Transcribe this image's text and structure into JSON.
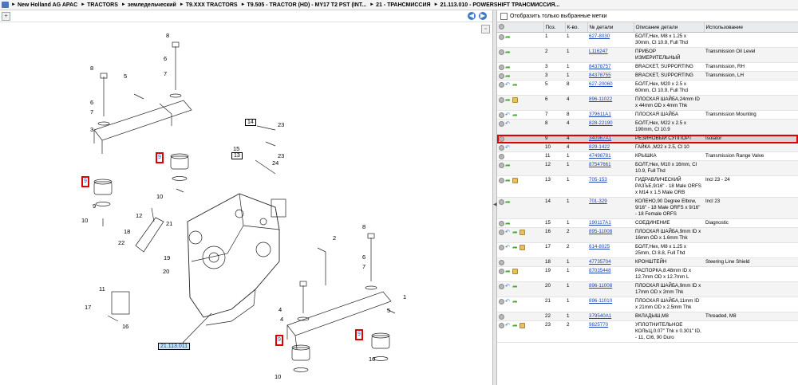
{
  "breadcrumb": [
    "New Holland AG APAC",
    "TRACTORS",
    "земледельческий",
    "T9.XXX TRACTORS",
    "T9.505 - TRACTOR (HD) - MY17 T2 PST (INT...",
    "21 - ТРАНСМИССИЯ",
    "21.113.010 - POWERSHIFT ТРАНСМИССИЯ..."
  ],
  "filter": {
    "label": "Отобразить только выбранные метки"
  },
  "table": {
    "headers": [
      "",
      "Поз.",
      "К-во.",
      "№ детали",
      "Описание детали",
      "Использование"
    ],
    "rows": [
      {
        "pos": "1",
        "qty": "1",
        "part": "627-8030",
        "desc": "БОЛТ,Hex, M8 x 1.25 x 30mm, Cl 10.9, Full Thd",
        "use": "",
        "icons": [
          "gray",
          "fwd"
        ]
      },
      {
        "pos": "2",
        "qty": "1",
        "part": "L116247",
        "desc": "ПРИБОР ИЗМЕРИТЕЛЬНЫЙ",
        "use": "Transmission Oil Level",
        "icons": [
          "gray",
          "fwd"
        ]
      },
      {
        "pos": "3",
        "qty": "1",
        "part": "84378757",
        "desc": "BRACKET, SUPPORTING",
        "use": "Transmission, RH",
        "icons": [
          "gray",
          "fwd"
        ]
      },
      {
        "pos": "3",
        "qty": "1",
        "part": "84378755",
        "desc": "BRACKET, SUPPORTING",
        "use": "Transmission, LH",
        "icons": [
          "gray",
          "fwd"
        ]
      },
      {
        "pos": "5",
        "qty": "8",
        "part": "627-20060",
        "desc": "БОЛТ,Hex, M20 x 2.5 x 60mm, Cl 10.9, Full Thd",
        "use": "",
        "icons": [
          "gray",
          "back",
          "fwd"
        ]
      },
      {
        "pos": "6",
        "qty": "4",
        "part": "896-11022",
        "desc": "ПЛОСКАЯ ШАЙБА,24mm ID x 44mm OD x 4mm Thk",
        "use": "",
        "icons": [
          "gray",
          "fwd",
          "box"
        ]
      },
      {
        "pos": "7",
        "qty": "8",
        "part": "379611A1",
        "desc": "ПЛОСКАЯ ШАЙБА",
        "use": "Transmission Mounting",
        "icons": [
          "gray",
          "back",
          "fwd"
        ]
      },
      {
        "pos": "8",
        "qty": "4",
        "part": "828-22190",
        "desc": "БОЛТ,Hex, M22 x 2.5 x 190mm, Cl 10.9",
        "use": "",
        "icons": [
          "gray",
          "back"
        ]
      },
      {
        "pos": "9",
        "qty": "4",
        "part": "340967A1",
        "desc": "РЕЗИНОВЫЙ СУППОРТ",
        "use": "Isolator",
        "icons": [
          "gray"
        ],
        "selected": true
      },
      {
        "pos": "10",
        "qty": "4",
        "part": "829-1422",
        "desc": "ГАЙКА ,M22 x 2.5, Cl 10",
        "use": "",
        "icons": [
          "gray",
          "back"
        ]
      },
      {
        "pos": "11",
        "qty": "1",
        "part": "47498781",
        "desc": "КРЫШКА",
        "use": "Transmission Range Valve",
        "icons": [
          "gray"
        ]
      },
      {
        "pos": "12",
        "qty": "1",
        "part": "87547661",
        "desc": "БОЛТ,Hex, M10 x 16mm, Cl 10.9, Full Thd",
        "use": "",
        "icons": [
          "gray",
          "fwd"
        ]
      },
      {
        "pos": "13",
        "qty": "1",
        "part": "705-153",
        "desc": "ГИДРАВЛИЧЕСКИЙ РАЗЪЕ,9/16\" - 18 Male ORFS x M14 x 1.5 Male ORB",
        "use": "Incl 23 - 24",
        "icons": [
          "gray",
          "fwd",
          "box"
        ]
      },
      {
        "pos": "14",
        "qty": "1",
        "part": "701-329",
        "desc": "КОЛЕНО,90 Degree Elbow, 9/16\" - 18 Male ORFS x 9/16\" - 18 Female ORFS",
        "use": "Incl 23",
        "icons": [
          "gray",
          "fwd"
        ]
      },
      {
        "pos": "15",
        "qty": "1",
        "part": "190117A1",
        "desc": "СОЕДИНЕНИЕ",
        "use": "Diagnostic",
        "icons": [
          "gray",
          "fwd"
        ]
      },
      {
        "pos": "16",
        "qty": "2",
        "part": "895-11008",
        "desc": "ПЛОСКАЯ ШАЙБА,9mm ID x 16mm OD x 1.6mm Thk",
        "use": "",
        "icons": [
          "gray",
          "back",
          "fwd",
          "box"
        ]
      },
      {
        "pos": "17",
        "qty": "2",
        "part": "614-8025",
        "desc": "БОЛТ,Hex, M8 x 1.25 x 25mm, Cl 8.8, Full Thd",
        "use": "",
        "icons": [
          "gray",
          "back",
          "fwd",
          "box"
        ]
      },
      {
        "pos": "18",
        "qty": "1",
        "part": "47735704",
        "desc": "КРОНШТЕЙН",
        "use": "Steering Line Shield",
        "icons": [
          "gray"
        ]
      },
      {
        "pos": "19",
        "qty": "1",
        "part": "87035448",
        "desc": "РАСПОРКА,8.48mm ID x 12.7mm OD x 12.7mm L",
        "use": "",
        "icons": [
          "gray",
          "fwd",
          "box"
        ]
      },
      {
        "pos": "20",
        "qty": "1",
        "part": "896-11008",
        "desc": "ПЛОСКАЯ ШАЙБА,9mm ID x 17mm OD x 2mm Thk",
        "use": "",
        "icons": [
          "gray",
          "back",
          "fwd"
        ]
      },
      {
        "pos": "21",
        "qty": "1",
        "part": "896-11010",
        "desc": "ПЛОСКАЯ ШАЙБА,11mm ID x 21mm OD x 2.5mm Thk",
        "use": "",
        "icons": [
          "gray",
          "back",
          "fwd"
        ]
      },
      {
        "pos": "22",
        "qty": "1",
        "part": "379540A1",
        "desc": "ВКЛАДЫШ,M8",
        "use": "Threaded, M8",
        "icons": [
          "gray"
        ]
      },
      {
        "pos": "23",
        "qty": "2",
        "part": "9825770",
        "desc": "УПЛОТНИТЕЛЬНОЕ КОЛЬЦ,0.07\" Thk x 0.301\" ID, - 11, CI6, 90 Duro",
        "use": "",
        "icons": [
          "gray",
          "back",
          "fwd",
          "box"
        ]
      }
    ]
  },
  "drawing": {
    "figure_label": "21.113.011",
    "callouts": [
      "8",
      "6",
      "7",
      "8",
      "5",
      "6",
      "7",
      "3",
      "9",
      "9",
      "10",
      "9",
      "10",
      "14",
      "15",
      "13",
      "23",
      "23",
      "24",
      "12",
      "21",
      "18",
      "22",
      "19",
      "20",
      "11",
      "17",
      "16",
      "2",
      "8",
      "4",
      "1",
      "6",
      "7",
      "4",
      "5",
      "9",
      "10",
      "9",
      "10"
    ]
  }
}
